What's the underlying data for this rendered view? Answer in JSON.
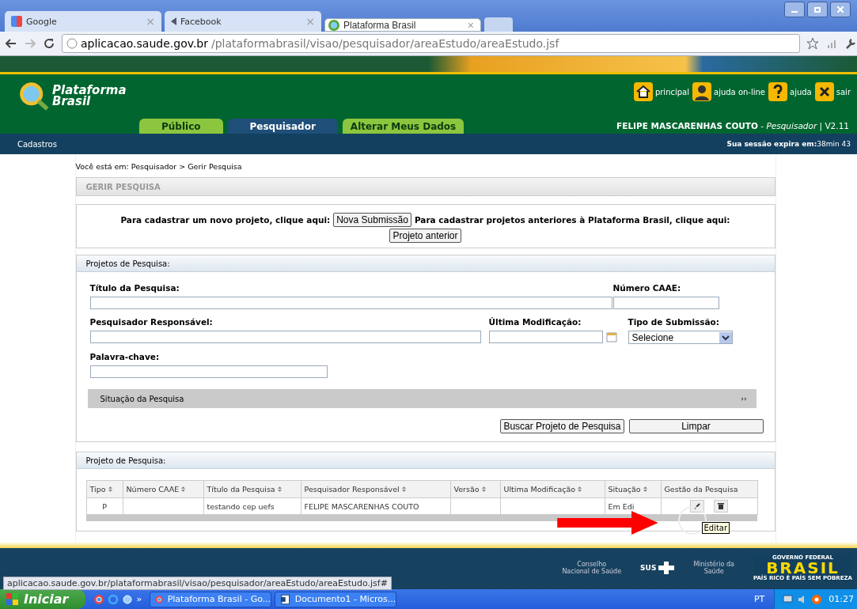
{
  "browser": {
    "tab_close": "×",
    "tabs": [
      {
        "label": "Google",
        "selected": false,
        "kind": "google"
      },
      {
        "label": "Facebook",
        "selected": false,
        "kind": "facebook"
      },
      {
        "label": "Plataforma Brasil",
        "selected": true,
        "kind": "site"
      }
    ],
    "address": {
      "host": "aplicacao.saude.gov.br",
      "path": "/plataformabrasil/visao/pesquisador/areaEstudo/areaEstudo.jsf"
    }
  },
  "header": {
    "logo": [
      "Plataforma",
      "Brasil"
    ],
    "nav": [
      {
        "label": "principal",
        "kind": "home"
      },
      {
        "label": "ajuda on-line",
        "kind": "person"
      },
      {
        "label": "ajuda",
        "kind": "help"
      },
      {
        "label": "sair",
        "kind": "exit"
      }
    ],
    "tabs": [
      {
        "label": "Público",
        "selected": false
      },
      {
        "label": "Pesquisador",
        "selected": true
      },
      {
        "label": "Alterar Meus Dados",
        "selected": false
      }
    ],
    "user": "**FELIPE MASCARENHAS COUTO** - *Pesquisador* | V2.11",
    "menu": "Cadastros",
    "session_label": "Sua sessão expira em:",
    "session_time": "38min 43"
  },
  "breadcrumb": "Você está em: Pesquisador > Gerir Pesquisa",
  "page_title": "GERIR PESQUISA",
  "intro": {
    "new_text": "Para cadastrar um novo projeto, clique aqui:",
    "new_button": "Nova Submissão",
    "old_text": "Para cadastrar projetos anteriores à Plataforma Brasil, clique aqui:",
    "old_button": "Projeto anterior"
  },
  "filters": {
    "title": "Projetos de Pesquisa:",
    "fields": [
      {
        "label": "Título da Pesquisa:",
        "kind": "text"
      },
      {
        "label": "Número CAAE:",
        "kind": "text"
      },
      {
        "label": "Pesquisador Responsável:",
        "kind": "text"
      },
      {
        "label": "Última Modificação:",
        "kind": "date"
      },
      {
        "label": "Tipo de Submissão:",
        "kind": "select",
        "value": "Selecione"
      },
      {
        "label": "Palavra-chave:",
        "kind": "text"
      }
    ],
    "situation": "Situação da Pesquisa",
    "expand": "››",
    "buttons": [
      "Buscar Projeto de Pesquisa",
      "Limpar"
    ]
  },
  "results": {
    "title": "Projeto de Pesquisa:",
    "columns": [
      {
        "label": "Tipo",
        "sortable": true
      },
      {
        "label": "Número CAAE",
        "sortable": true
      },
      {
        "label": "Título da Pesquisa",
        "sortable": true
      },
      {
        "label": "Pesquisador Responsável",
        "sortable": true
      },
      {
        "label": "Versão",
        "sortable": true
      },
      {
        "label": "Ultima Modificação",
        "sortable": true
      },
      {
        "label": "Situação",
        "sortable": true
      },
      {
        "label": "Gestão da Pesquisa",
        "sortable": false
      }
    ],
    "rows": [
      {
        "cells": [
          "P",
          "",
          "testando cep uefs",
          "FELIPE MASCARENHAS COUTO",
          "",
          "",
          "Em Edi"
        ]
      }
    ],
    "tooltip": "Editar"
  },
  "footer": {
    "logos": [
      {
        "lines": [
          "Conselho",
          "Nacional de Saúde"
        ],
        "kind": "text"
      },
      {
        "lines": [
          "SUS"
        ],
        "kind": "sus"
      },
      {
        "lines": [
          "Ministério da",
          "Saúde"
        ],
        "kind": "text"
      },
      {
        "lines": [
          "GOVERNO FEDERAL",
          "BRASIL",
          "PAÍS RICO É PAÍS SEM POBREZA"
        ],
        "kind": "brasil"
      }
    ]
  },
  "status_url": "aplicacao.saude.gov.br/plataformabrasil/visao/pesquisador/areaEstudo/areaEstudo.jsf#",
  "taskbar": {
    "start": "Iniciar",
    "more": "»",
    "tasks": [
      {
        "label": "Plataforma Brasil - Go...",
        "kind": "browser"
      },
      {
        "label": "Documento1 - Micros...",
        "kind": "doc"
      }
    ],
    "lang": "PT",
    "time": "01:27"
  }
}
